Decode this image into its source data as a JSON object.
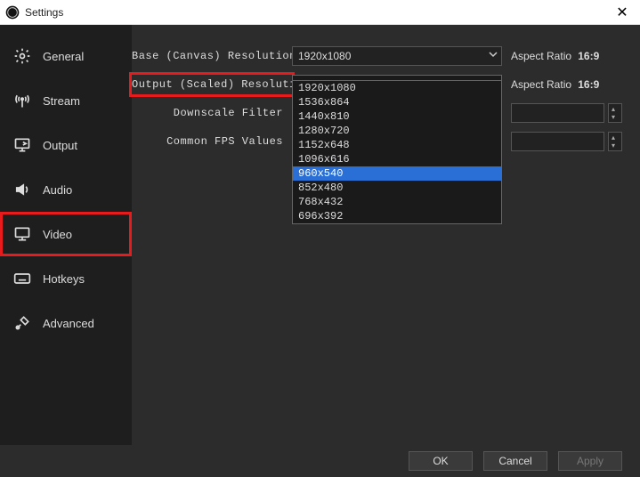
{
  "window": {
    "title": "Settings",
    "close_glyph": "✕"
  },
  "sidebar": {
    "items": [
      {
        "label": "General"
      },
      {
        "label": "Stream"
      },
      {
        "label": "Output"
      },
      {
        "label": "Audio"
      },
      {
        "label": "Video"
      },
      {
        "label": "Hotkeys"
      },
      {
        "label": "Advanced"
      }
    ]
  },
  "video": {
    "base": {
      "label": "Base (Canvas) Resolution",
      "value": "1920x1080",
      "aspect_label": "Aspect Ratio",
      "aspect_value": "16:9"
    },
    "output": {
      "label": "Output (Scaled) Resolution",
      "value": "1920x1080",
      "aspect_label": "Aspect Ratio",
      "aspect_value": "16:9",
      "options": [
        "1920x1080",
        "1536x864",
        "1440x810",
        "1280x720",
        "1152x648",
        "1096x616",
        "960x540",
        "852x480",
        "768x432",
        "696x392"
      ],
      "selected_index": 6
    },
    "filter": {
      "label": "Downscale Filter",
      "value": ""
    },
    "fps": {
      "label": "Common FPS Values",
      "value": ""
    }
  },
  "footer": {
    "ok": "OK",
    "cancel": "Cancel",
    "apply": "Apply"
  }
}
